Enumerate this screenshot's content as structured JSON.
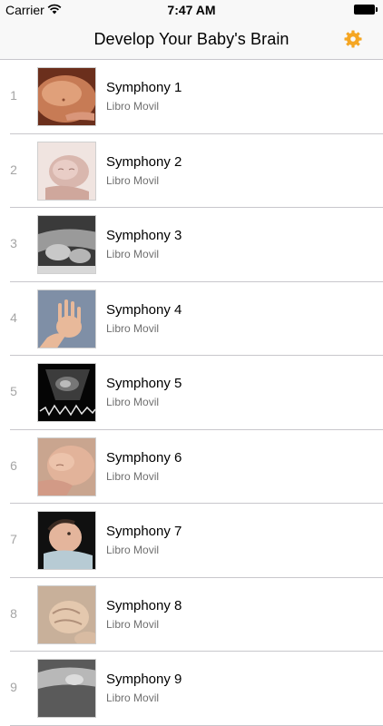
{
  "status": {
    "carrier": "Carrier",
    "time": "7:47 AM"
  },
  "nav": {
    "title": "Develop Your Baby's Brain",
    "accent": "#f5a623",
    "settings_icon": "gear-icon"
  },
  "tracks": [
    {
      "number": "1",
      "title": "Symphony 1",
      "artist": "Libro Movil",
      "image": "pregnant-belly"
    },
    {
      "number": "2",
      "title": "Symphony 2",
      "artist": "Libro Movil",
      "image": "sleeping-newborn"
    },
    {
      "number": "3",
      "title": "Symphony 3",
      "artist": "Libro Movil",
      "image": "baby-feet-bw"
    },
    {
      "number": "4",
      "title": "Symphony 4",
      "artist": "Libro Movil",
      "image": "baby-hand"
    },
    {
      "number": "5",
      "title": "Symphony 5",
      "artist": "Libro Movil",
      "image": "ultrasound-scan"
    },
    {
      "number": "6",
      "title": "Symphony 6",
      "artist": "Libro Movil",
      "image": "sleeping-baby-face"
    },
    {
      "number": "7",
      "title": "Symphony 7",
      "artist": "Libro Movil",
      "image": "baby-looking-up"
    },
    {
      "number": "8",
      "title": "Symphony 8",
      "artist": "Libro Movil",
      "image": "baby-fist"
    },
    {
      "number": "9",
      "title": "Symphony 9",
      "artist": "Libro Movil",
      "image": "baby-bw"
    }
  ]
}
